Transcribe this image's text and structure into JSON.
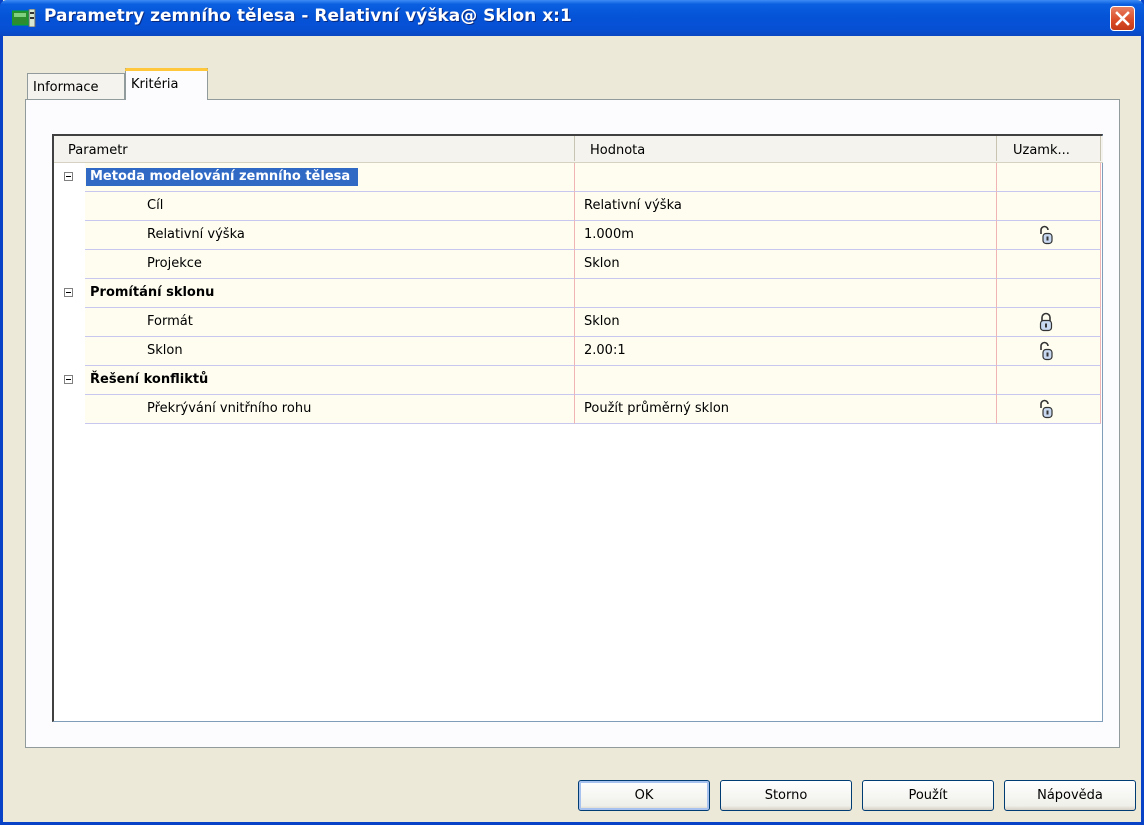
{
  "window": {
    "title": "Parametry zemního tělesa - Relativní výška@ Sklon x:1"
  },
  "tabs": [
    {
      "label": "Informace",
      "active": false
    },
    {
      "label": "Kritéria",
      "active": true
    }
  ],
  "grid": {
    "columns": {
      "parameter": "Parametr",
      "value": "Hodnota",
      "lock": "Uzamk..."
    },
    "rows": [
      {
        "type": "category",
        "label": "Metoda modelování zemního tělesa",
        "selected": true
      },
      {
        "type": "item",
        "label": "Cíl",
        "value": "Relativní výška",
        "lock": ""
      },
      {
        "type": "item",
        "label": "Relativní výška",
        "value": "1.000m",
        "lock": "unlocked-icon"
      },
      {
        "type": "item",
        "label": "Projekce",
        "value": "Sklon",
        "lock": ""
      },
      {
        "type": "category",
        "label": "Promítání sklonu",
        "selected": false
      },
      {
        "type": "item",
        "label": "Formát",
        "value": "Sklon",
        "lock": "locked-icon"
      },
      {
        "type": "item",
        "label": "Sklon",
        "value": "2.00:1",
        "lock": "unlocked-icon"
      },
      {
        "type": "category",
        "label": "Řešení konfliktů",
        "selected": false
      },
      {
        "type": "item",
        "label": "Překrývání vnitřního rohu",
        "value": "Použít průměrný sklon",
        "lock": "unlocked-icon"
      }
    ]
  },
  "buttons": {
    "ok": "OK",
    "cancel": "Storno",
    "apply": "Použít",
    "help": "Nápověda"
  },
  "colors": {
    "titlebar": "#0553d7",
    "selection": "#316ac5",
    "row_bg": "#fefdf0",
    "tab_accent": "#ffc83c"
  }
}
